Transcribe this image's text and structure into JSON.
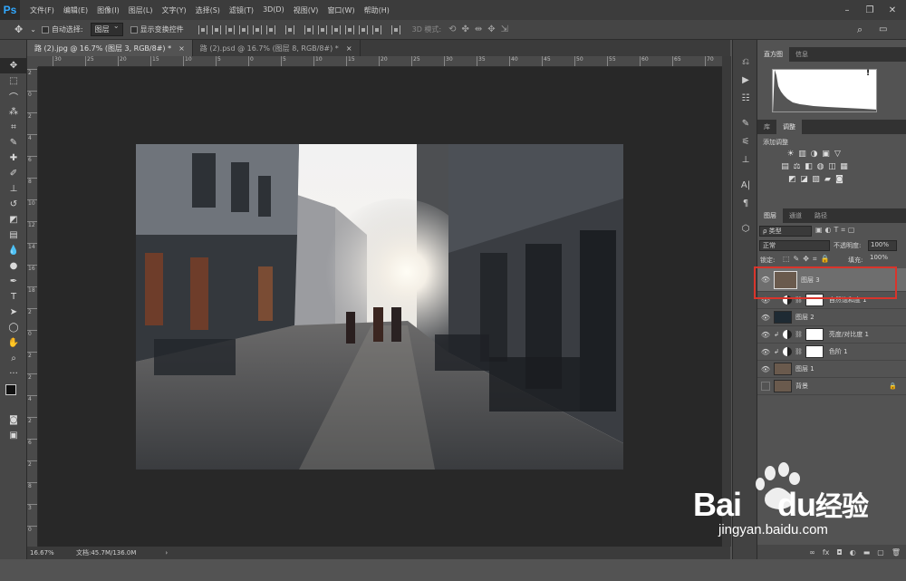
{
  "app": {
    "logo": "Ps"
  },
  "menu": [
    "文件(F)",
    "编辑(E)",
    "图像(I)",
    "图层(L)",
    "文字(Y)",
    "选择(S)",
    "滤镜(T)",
    "3D(D)",
    "视图(V)",
    "窗口(W)",
    "帮助(H)"
  ],
  "window_controls": {
    "minimize": "–",
    "restore": "❐",
    "close": "✕"
  },
  "options": {
    "auto_select_label": "自动选择:",
    "auto_select_value": "图层",
    "show_transform_label": "显示变换控件",
    "mode_3d_label": "3D 模式:"
  },
  "tabs": [
    {
      "title": "路 (2).jpg @ 16.7% (图层 3, RGB/8#) *",
      "close": "×"
    },
    {
      "title": "路 (2).psd @ 16.7% (图层 8, RGB/8#) *",
      "close": "×"
    }
  ],
  "ruler": {
    "top": [
      "30",
      "25",
      "20",
      "15",
      "10",
      "5",
      "0",
      "5",
      "10",
      "15",
      "20",
      "25",
      "30",
      "35",
      "40",
      "45",
      "50",
      "55",
      "60",
      "65",
      "70"
    ],
    "left": [
      "2",
      "0",
      "2",
      "4",
      "6",
      "8",
      "10",
      "12",
      "14",
      "16",
      "18",
      "2",
      "0",
      "2",
      "2",
      "4",
      "2",
      "6",
      "2",
      "8",
      "3",
      "0"
    ]
  },
  "status": {
    "zoom": "16.67%",
    "doc": "文档:45.7M/136.0M",
    "arrow": "›"
  },
  "panels": {
    "histogram_tabs": [
      "直方图",
      "信息"
    ],
    "histogram_warning": "!",
    "adjust_tabs": [
      "库",
      "调整"
    ],
    "adjust_title": "添加调整",
    "adjust_row1": [
      "☀",
      "▥",
      "◑",
      "▣",
      "▽"
    ],
    "adjust_row2": [
      "▤",
      "⚖",
      "◧",
      "◍",
      "◫",
      "▦"
    ],
    "adjust_row3": [
      "◩",
      "◪",
      "▧",
      "▰",
      "◙"
    ],
    "layers_tabs": [
      "图层",
      "通道",
      "路径"
    ],
    "filter_kind": "ρ 类型",
    "blend_mode": "正常",
    "opacity_label": "不透明度:",
    "opacity_value": "100%",
    "lock_label": "锁定:",
    "fill_label": "填充:",
    "fill_value": "100%",
    "layers": [
      {
        "name": "图层 3",
        "type": "pixel",
        "selected": true,
        "visible": true
      },
      {
        "name": "自然饱和度 1",
        "type": "adjustment",
        "visible": true
      },
      {
        "name": "图层 2",
        "type": "solid",
        "visible": true
      },
      {
        "name": "亮度/对比度 1",
        "type": "adjustment",
        "visible": true
      },
      {
        "name": "色阶 1",
        "type": "adjustment",
        "visible": true
      },
      {
        "name": "图层 1",
        "type": "pixel",
        "visible": true
      },
      {
        "name": "背景",
        "type": "background",
        "visible": false,
        "locked": true
      }
    ],
    "bottom_icons": [
      "∞",
      "fx",
      "◘",
      "◐",
      "▬",
      "▢",
      "🗑"
    ]
  },
  "watermark": {
    "brand": "Bai",
    "brand2": "du",
    "cn": "经验",
    "url": "jingyan.baidu.com"
  },
  "colors": {
    "accent": "#31a8ff",
    "highlight": "#d9342b"
  }
}
